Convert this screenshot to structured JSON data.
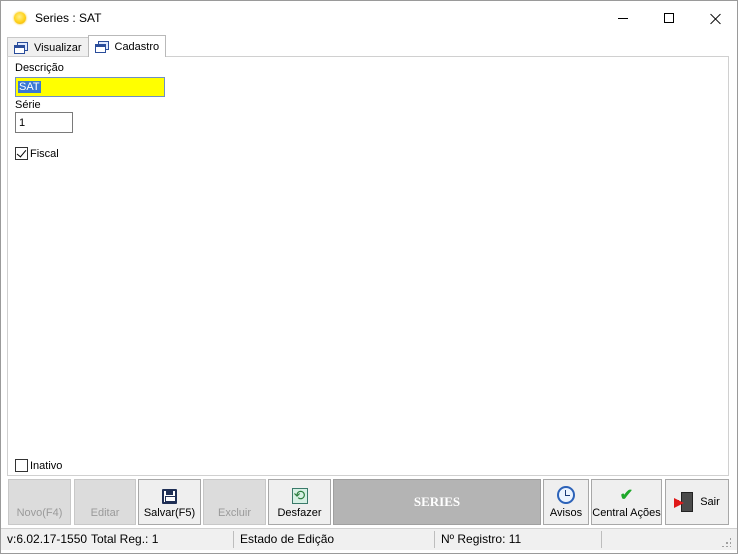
{
  "window": {
    "title": "Series  : SAT",
    "icon": "sun-icon"
  },
  "tabs": [
    {
      "label": "Visualizar",
      "active": false,
      "icon": "window-icon"
    },
    {
      "label": "Cadastro",
      "active": true,
      "icon": "window-icon"
    }
  ],
  "form": {
    "descricao_label": "Descrição",
    "descricao_value": "SAT",
    "serie_label": "Série",
    "serie_value": "1",
    "fiscal_label": "Fiscal",
    "fiscal_checked": true,
    "inativo_label": "Inativo",
    "inativo_checked": false
  },
  "toolbar": {
    "novo_label": "Novo(F4)",
    "editar_label": "Editar",
    "salvar_label": "Salvar(F5)",
    "excluir_label": "Excluir",
    "desfazer_label": "Desfazer",
    "banner_label": "SERIES",
    "avisos_label": "Avisos",
    "central_label": "Central Ações",
    "sair_label": "Sair"
  },
  "status": {
    "version": "v:6.02.17-1550",
    "total": "Total Reg.: 1",
    "estado": "Estado de Edição",
    "registro": "Nº Registro: 11"
  },
  "colors": {
    "field_highlight": "#ffff00",
    "selection": "#3a78d4",
    "banner_bg": "#b4b4b4"
  }
}
